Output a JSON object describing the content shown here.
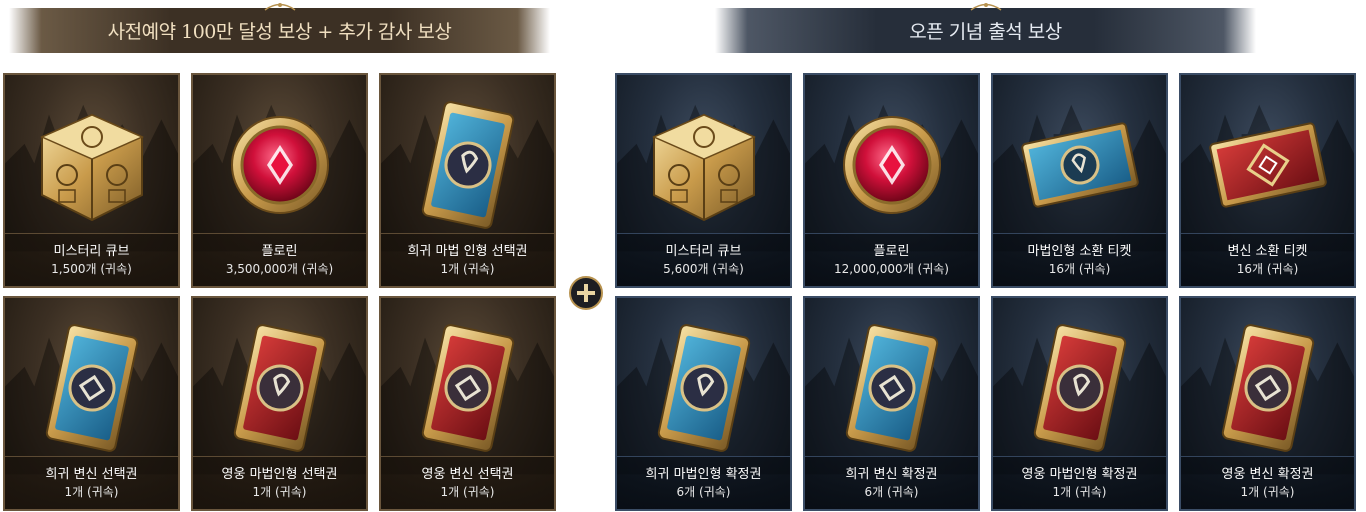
{
  "left_section": {
    "title": "사전예약 100만 달성 보상 + 추가 감사 보상",
    "cards": [
      {
        "name": "미스터리 큐브",
        "qty": "1,500개 (귀속)",
        "icon": "mystery-cube-icon"
      },
      {
        "name": "플로린",
        "qty": "3,500,000개 (귀속)",
        "icon": "florin-coin-icon"
      },
      {
        "name": "희귀 마법 인형 선택권",
        "qty": "1개 (귀속)",
        "icon": "rare-doll-card-icon"
      },
      {
        "name": "희귀 변신 선택권",
        "qty": "1개 (귀속)",
        "icon": "rare-transform-card-icon"
      },
      {
        "name": "영웅 마법인형 선택권",
        "qty": "1개 (귀속)",
        "icon": "hero-doll-card-icon"
      },
      {
        "name": "영웅 변신 선택권",
        "qty": "1개 (귀속)",
        "icon": "hero-transform-card-icon"
      }
    ]
  },
  "plus_label": "+",
  "right_section": {
    "title": "오픈 기념 출석 보상",
    "cards": [
      {
        "name": "미스터리 큐브",
        "qty": "5,600개  (귀속)",
        "icon": "mystery-cube-icon"
      },
      {
        "name": "플로린",
        "qty": "12,000,000개 (귀속)",
        "icon": "florin-coin-icon"
      },
      {
        "name": "마법인형 소환 티켓",
        "qty": "16개 (귀속)",
        "icon": "doll-summon-ticket-icon"
      },
      {
        "name": "변신 소환 티켓",
        "qty": "16개 (귀속)",
        "icon": "transform-summon-ticket-icon"
      },
      {
        "name": "희귀 마법인형 확정권",
        "qty": "6개 (귀속)",
        "icon": "rare-doll-card-icon"
      },
      {
        "name": "희귀 변신 확정권",
        "qty": "6개 (귀속)",
        "icon": "rare-transform-card-icon"
      },
      {
        "name": "영웅 마법인형 확정권",
        "qty": "1개 (귀속)",
        "icon": "hero-doll-card-icon"
      },
      {
        "name": "영웅 변신 확정권",
        "qty": "1개 (귀속)",
        "icon": "hero-transform-card-icon"
      }
    ]
  },
  "colors": {
    "gold_frame": "#6a563d",
    "blue_frame": "#3b4d66",
    "caption_text": "#ffffff"
  }
}
